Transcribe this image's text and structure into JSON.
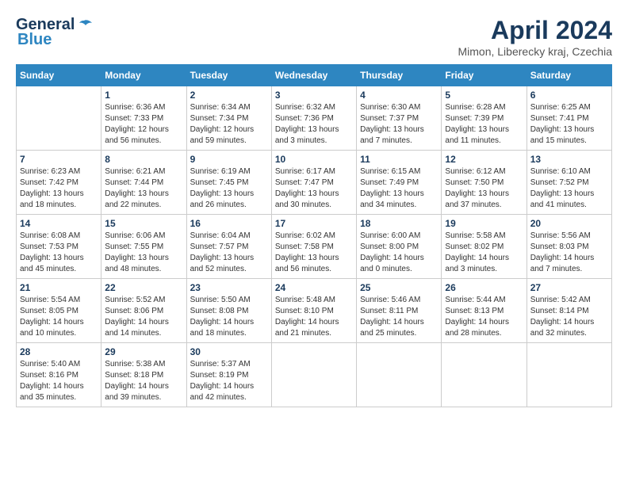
{
  "header": {
    "logo_line1": "General",
    "logo_line2": "Blue",
    "month_title": "April 2024",
    "location": "Mimon, Liberecky kraj, Czechia"
  },
  "days_of_week": [
    "Sunday",
    "Monday",
    "Tuesday",
    "Wednesday",
    "Thursday",
    "Friday",
    "Saturday"
  ],
  "weeks": [
    [
      {
        "day": "",
        "info": ""
      },
      {
        "day": "1",
        "info": "Sunrise: 6:36 AM\nSunset: 7:33 PM\nDaylight: 12 hours\nand 56 minutes."
      },
      {
        "day": "2",
        "info": "Sunrise: 6:34 AM\nSunset: 7:34 PM\nDaylight: 12 hours\nand 59 minutes."
      },
      {
        "day": "3",
        "info": "Sunrise: 6:32 AM\nSunset: 7:36 PM\nDaylight: 13 hours\nand 3 minutes."
      },
      {
        "day": "4",
        "info": "Sunrise: 6:30 AM\nSunset: 7:37 PM\nDaylight: 13 hours\nand 7 minutes."
      },
      {
        "day": "5",
        "info": "Sunrise: 6:28 AM\nSunset: 7:39 PM\nDaylight: 13 hours\nand 11 minutes."
      },
      {
        "day": "6",
        "info": "Sunrise: 6:25 AM\nSunset: 7:41 PM\nDaylight: 13 hours\nand 15 minutes."
      }
    ],
    [
      {
        "day": "7",
        "info": "Sunrise: 6:23 AM\nSunset: 7:42 PM\nDaylight: 13 hours\nand 18 minutes."
      },
      {
        "day": "8",
        "info": "Sunrise: 6:21 AM\nSunset: 7:44 PM\nDaylight: 13 hours\nand 22 minutes."
      },
      {
        "day": "9",
        "info": "Sunrise: 6:19 AM\nSunset: 7:45 PM\nDaylight: 13 hours\nand 26 minutes."
      },
      {
        "day": "10",
        "info": "Sunrise: 6:17 AM\nSunset: 7:47 PM\nDaylight: 13 hours\nand 30 minutes."
      },
      {
        "day": "11",
        "info": "Sunrise: 6:15 AM\nSunset: 7:49 PM\nDaylight: 13 hours\nand 34 minutes."
      },
      {
        "day": "12",
        "info": "Sunrise: 6:12 AM\nSunset: 7:50 PM\nDaylight: 13 hours\nand 37 minutes."
      },
      {
        "day": "13",
        "info": "Sunrise: 6:10 AM\nSunset: 7:52 PM\nDaylight: 13 hours\nand 41 minutes."
      }
    ],
    [
      {
        "day": "14",
        "info": "Sunrise: 6:08 AM\nSunset: 7:53 PM\nDaylight: 13 hours\nand 45 minutes."
      },
      {
        "day": "15",
        "info": "Sunrise: 6:06 AM\nSunset: 7:55 PM\nDaylight: 13 hours\nand 48 minutes."
      },
      {
        "day": "16",
        "info": "Sunrise: 6:04 AM\nSunset: 7:57 PM\nDaylight: 13 hours\nand 52 minutes."
      },
      {
        "day": "17",
        "info": "Sunrise: 6:02 AM\nSunset: 7:58 PM\nDaylight: 13 hours\nand 56 minutes."
      },
      {
        "day": "18",
        "info": "Sunrise: 6:00 AM\nSunset: 8:00 PM\nDaylight: 14 hours\nand 0 minutes."
      },
      {
        "day": "19",
        "info": "Sunrise: 5:58 AM\nSunset: 8:02 PM\nDaylight: 14 hours\nand 3 minutes."
      },
      {
        "day": "20",
        "info": "Sunrise: 5:56 AM\nSunset: 8:03 PM\nDaylight: 14 hours\nand 7 minutes."
      }
    ],
    [
      {
        "day": "21",
        "info": "Sunrise: 5:54 AM\nSunset: 8:05 PM\nDaylight: 14 hours\nand 10 minutes."
      },
      {
        "day": "22",
        "info": "Sunrise: 5:52 AM\nSunset: 8:06 PM\nDaylight: 14 hours\nand 14 minutes."
      },
      {
        "day": "23",
        "info": "Sunrise: 5:50 AM\nSunset: 8:08 PM\nDaylight: 14 hours\nand 18 minutes."
      },
      {
        "day": "24",
        "info": "Sunrise: 5:48 AM\nSunset: 8:10 PM\nDaylight: 14 hours\nand 21 minutes."
      },
      {
        "day": "25",
        "info": "Sunrise: 5:46 AM\nSunset: 8:11 PM\nDaylight: 14 hours\nand 25 minutes."
      },
      {
        "day": "26",
        "info": "Sunrise: 5:44 AM\nSunset: 8:13 PM\nDaylight: 14 hours\nand 28 minutes."
      },
      {
        "day": "27",
        "info": "Sunrise: 5:42 AM\nSunset: 8:14 PM\nDaylight: 14 hours\nand 32 minutes."
      }
    ],
    [
      {
        "day": "28",
        "info": "Sunrise: 5:40 AM\nSunset: 8:16 PM\nDaylight: 14 hours\nand 35 minutes."
      },
      {
        "day": "29",
        "info": "Sunrise: 5:38 AM\nSunset: 8:18 PM\nDaylight: 14 hours\nand 39 minutes."
      },
      {
        "day": "30",
        "info": "Sunrise: 5:37 AM\nSunset: 8:19 PM\nDaylight: 14 hours\nand 42 minutes."
      },
      {
        "day": "",
        "info": ""
      },
      {
        "day": "",
        "info": ""
      },
      {
        "day": "",
        "info": ""
      },
      {
        "day": "",
        "info": ""
      }
    ]
  ]
}
